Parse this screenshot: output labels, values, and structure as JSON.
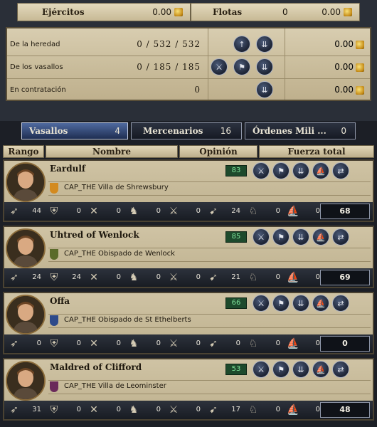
{
  "summary": {
    "armies_label": "Ejércitos",
    "armies_gold": "0.00",
    "fleets_label": "Flotas",
    "fleets_count": "0",
    "fleets_gold": "0.00",
    "rows": [
      {
        "label": "De la heredad",
        "values": "0  /  532  /  532",
        "gold": "0.00"
      },
      {
        "label": "De los vasallos",
        "values": "0  /  185  /  185",
        "gold": "0.00"
      },
      {
        "label": "En contratación",
        "values": "0",
        "gold": "0.00"
      }
    ]
  },
  "tabs": [
    {
      "label": "Vasallos",
      "count": "4"
    },
    {
      "label": "Mercenarios",
      "count": "16"
    },
    {
      "label": "Órdenes Mili ...",
      "count": "0"
    }
  ],
  "columns": {
    "rank": "Rango",
    "name": "Nombre",
    "opinion": "Opinión",
    "strength": "Fuerza total"
  },
  "vassals": [
    {
      "name": "Eardulf",
      "opinion": "83",
      "title": "CAP_THE Villa de Shrewsbury",
      "stats": [
        "44",
        "0",
        "0",
        "0",
        "0",
        "24",
        "0",
        "0"
      ],
      "total": "68"
    },
    {
      "name": "Uhtred of Wenlock",
      "opinion": "85",
      "title": "CAP_THE Obispado de Wenlock",
      "stats": [
        "24",
        "24",
        "0",
        "0",
        "0",
        "21",
        "0",
        "0"
      ],
      "total": "69"
    },
    {
      "name": "Offa",
      "opinion": "66",
      "title": "CAP_THE Obispado de St Ethelberts",
      "stats": [
        "0",
        "0",
        "0",
        "0",
        "0",
        "0",
        "0",
        "0"
      ],
      "total": "0"
    },
    {
      "name": "Maldred of Clifford",
      "opinion": "53",
      "title": "CAP_THE Villa de Leominster",
      "stats": [
        "31",
        "0",
        "0",
        "0",
        "0",
        "17",
        "0",
        "0"
      ],
      "total": "48"
    }
  ],
  "colors": {
    "opinion_bg": "#1d4a2c",
    "opinion_text": "#7fe39a",
    "active_tab": "#3a5488"
  }
}
